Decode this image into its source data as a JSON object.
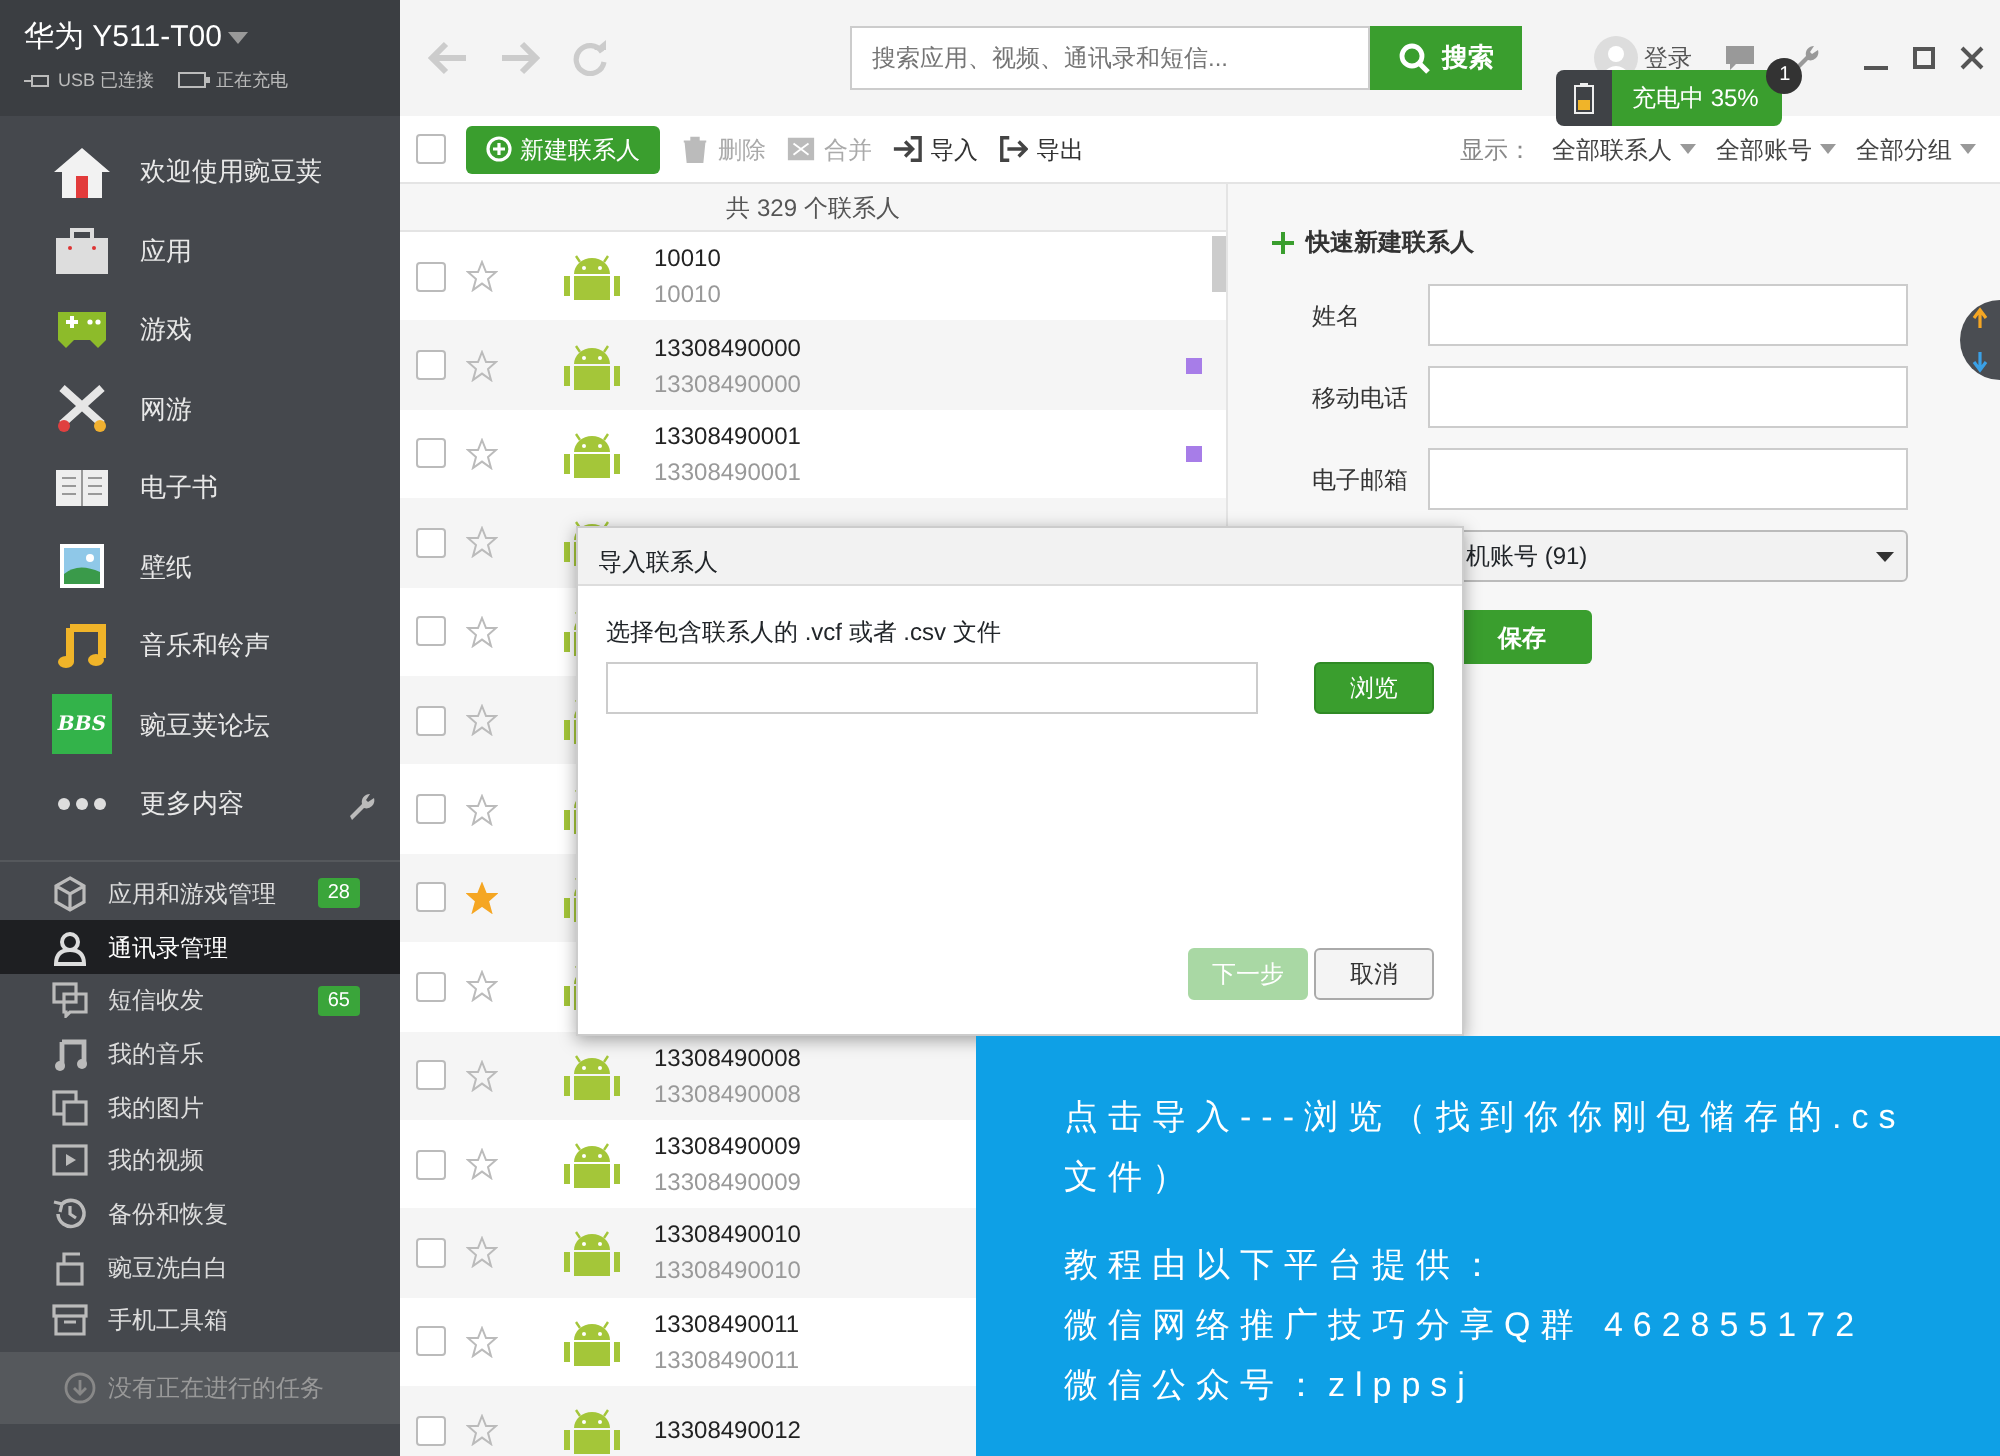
{
  "device": {
    "name": "华为 Y511-T00",
    "usb": "USB 已连接",
    "charging": "正在充电"
  },
  "nav": [
    {
      "label": "欢迎使用豌豆荚"
    },
    {
      "label": "应用"
    },
    {
      "label": "游戏"
    },
    {
      "label": "网游"
    },
    {
      "label": "电子书"
    },
    {
      "label": "壁纸"
    },
    {
      "label": "音乐和铃声"
    },
    {
      "label": "豌豆荚论坛",
      "icon_text": "BBS"
    },
    {
      "label": "更多内容"
    }
  ],
  "manage": [
    {
      "label": "应用和游戏管理",
      "badge": "28",
      "selected": false
    },
    {
      "label": "通讯录管理",
      "selected": true
    },
    {
      "label": "短信收发",
      "badge": "65",
      "selected": false
    },
    {
      "label": "我的音乐",
      "selected": false
    },
    {
      "label": "我的图片",
      "selected": false
    },
    {
      "label": "我的视频",
      "selected": false
    },
    {
      "label": "备份和恢复",
      "selected": false
    },
    {
      "label": "豌豆洗白白",
      "selected": false
    },
    {
      "label": "手机工具箱",
      "selected": false
    }
  ],
  "task_status": "没有正在进行的任务",
  "search": {
    "placeholder": "搜索应用、视频、通讯录和短信...",
    "button": "搜索"
  },
  "login": "登录",
  "charge_popup": {
    "text": "充电中 35%",
    "badge": "1"
  },
  "select_all": {
    "checked": false
  },
  "toolbar": {
    "new_button": "新建联系人",
    "actions": [
      {
        "label": "删除",
        "disabled": true
      },
      {
        "label": "合并",
        "disabled": true
      },
      {
        "label": "导入",
        "disabled": false
      },
      {
        "label": "导出",
        "disabled": false
      }
    ],
    "filter_label": "显示：",
    "filters": [
      "全部联系人",
      "全部账号",
      "全部分组"
    ]
  },
  "contacts": {
    "count": "共 329 个联系人",
    "rows": [
      {
        "name": "10010",
        "number": "10010",
        "starred": false,
        "checked": false
      },
      {
        "name": "13308490000",
        "number": "13308490000",
        "starred": false,
        "checked": false,
        "color": "#a77de8"
      },
      {
        "name": "13308490001",
        "number": "13308490001",
        "starred": false,
        "checked": false,
        "color": "#a77de8"
      },
      {
        "starred": false,
        "checked": false
      },
      {
        "starred": false,
        "checked": false
      },
      {
        "starred": false,
        "checked": false
      },
      {
        "starred": false,
        "checked": false
      },
      {
        "starred": true,
        "checked": false
      },
      {
        "starred": false,
        "checked": false
      },
      {
        "name": "13308490008",
        "number": "13308490008",
        "starred": false,
        "checked": false
      },
      {
        "name": "13308490009",
        "number": "13308490009",
        "starred": false,
        "checked": false
      },
      {
        "name": "13308490010",
        "number": "13308490010",
        "starred": false,
        "checked": false
      },
      {
        "name": "13308490011",
        "number": "13308490011",
        "starred": false,
        "checked": false
      },
      {
        "name": "13308490012",
        "starred": false,
        "checked": false
      }
    ]
  },
  "quick_add": {
    "title": "快速新建联系人",
    "fields": [
      {
        "label": "姓名"
      },
      {
        "label": "移动电话"
      },
      {
        "label": "电子邮箱"
      }
    ],
    "account": "机账号 (91)",
    "save": "保存"
  },
  "dialog": {
    "title": "导入联系人",
    "prompt": "选择包含联系人的 .vcf 或者 .csv 文件",
    "browse": "浏览",
    "next": {
      "label": "下一步",
      "disabled": true
    },
    "cancel": "取消"
  },
  "annotation": {
    "paragraphs": [
      [
        "点击导入---浏览（找到你你刚包储存的.cs",
        "文件）"
      ],
      [
        "教程由以下平台提供：",
        "微信网络推广技巧分享Q群 462855172",
        "微信公众号：zlppsj"
      ]
    ]
  }
}
